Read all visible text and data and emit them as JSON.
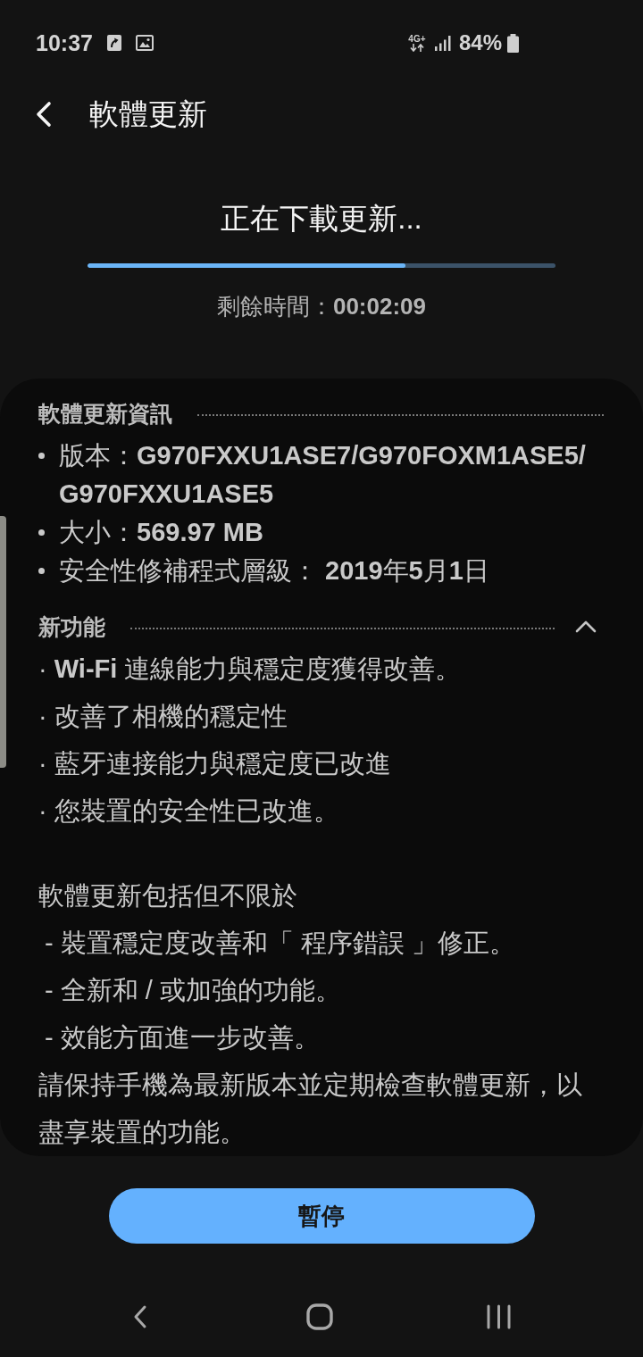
{
  "status_bar": {
    "time": "10:37",
    "network": "4G+",
    "battery": "84%"
  },
  "header": {
    "title": "軟體更新"
  },
  "download": {
    "title": "正在下載更新...",
    "progress": {
      "level": 0.68
    },
    "remaining": "剩餘時間：**00:02:09**"
  },
  "info_section": {
    "heading": "軟體更新資訊",
    "items": [
      "版本：**G970FXXU1ASE7/G970FOXM1ASE5/G970FXXU1ASE5**",
      "大小：**569.97 MB**",
      "安全性修補程式層級： **2019**年**5**月**1**日"
    ]
  },
  "features_section": {
    "heading": "新功能",
    "expanded": true,
    "items": [
      "· **Wi-Fi** 連線能力與穩定度獲得改善。",
      "· 改善了相機的穩定性",
      "· 藍牙連接能力與穩定度已改進",
      "· 您裝置的安全性已改進。"
    ],
    "notes": {
      "intro": "軟體更新包括但不限於",
      "items": [
        "- 裝置穩定度改善和「 程序錯誤 」修正。",
        "- 全新和 / 或加強的功能。",
        "- 效能方面進一步改善。"
      ],
      "footer": "請保持手機為最新版本並定期檢查軟體更新，以盡享裝置的功能。"
    }
  },
  "button": {
    "label": "暫停"
  }
}
